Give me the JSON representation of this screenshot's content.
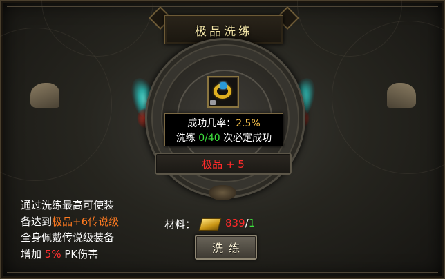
{
  "dialog": {
    "title": "极品洗练"
  },
  "item": {
    "icon": "bracelet-icon",
    "locked": true
  },
  "info": {
    "success_label": "成功几率：",
    "success_rate": "2.5%",
    "refine_label": "洗练 ",
    "refine_progress": "0/40",
    "guarantee_text": " 次必定成功"
  },
  "grade": {
    "text": "极品 + 5"
  },
  "description": {
    "line1": "通过洗练最高可使装",
    "line2_prefix": "备达到",
    "line2_highlight": "极品+6传说级",
    "line3": "全身佩戴传说级装备",
    "line4_prefix": "增加 ",
    "line4_highlight": "5%",
    "line4_suffix": " PK伤害"
  },
  "material": {
    "label": "材料：",
    "icon": "gold-bar-icon",
    "have": "839",
    "separator": "/",
    "need": "1"
  },
  "action": {
    "refine_button": "洗练"
  },
  "colors": {
    "title": "#f4e6a8",
    "rate": "#f5c04a",
    "progress": "#3ee03e",
    "grade": "#ff2a2a",
    "highlight_orange": "#ff7a20",
    "highlight_red": "#ff3030"
  }
}
